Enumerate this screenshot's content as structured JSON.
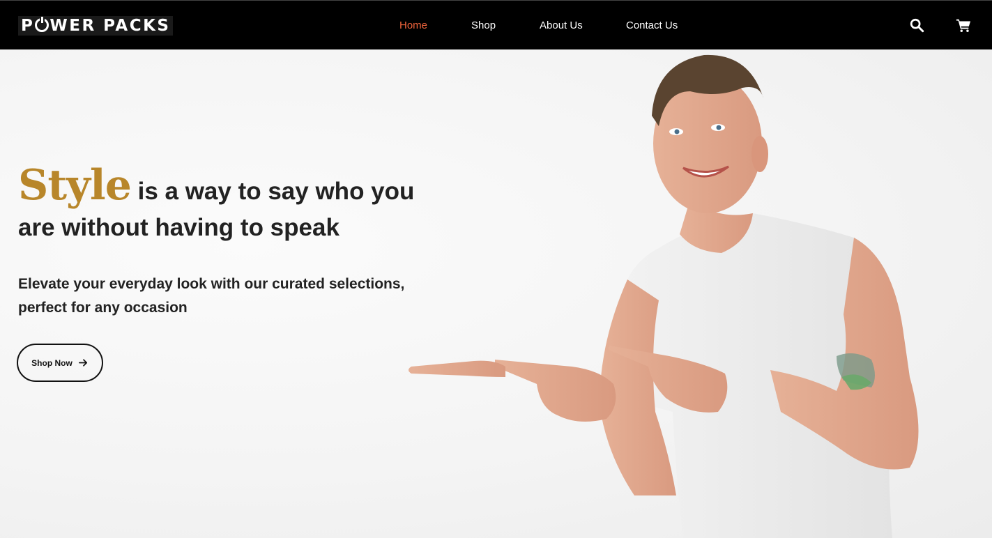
{
  "brand": {
    "name_part1": "P",
    "name_part2": "WER PACKS"
  },
  "nav": {
    "home": "Home",
    "shop": "Shop",
    "about": "About Us",
    "contact": "Contact Us",
    "active_color": "#f0643c"
  },
  "icons": {
    "search": "search-icon",
    "cart": "cart-icon",
    "arrow": "arrow-right-icon"
  },
  "hero": {
    "accent_word": "Style",
    "heading_rest": " is a way to say who you are without having to speak",
    "subheading": "Elevate your everyday look with our curated selections, perfect for any occasion",
    "cta_label": "Shop Now",
    "accent_color": "#b8862a"
  }
}
